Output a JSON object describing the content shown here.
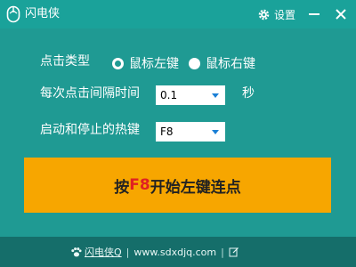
{
  "window": {
    "title": "闪电侠",
    "settings_label": "设置"
  },
  "form": {
    "click_type_label": "点击类型",
    "click_type_options": [
      "鼠标左键",
      "鼠标右键"
    ],
    "click_type_selected": "鼠标左键",
    "interval_label": "每次点击间隔时间",
    "interval_value": "0.1",
    "interval_unit": "秒",
    "hotkey_label": "启动和停止的热键",
    "hotkey_value": "F8"
  },
  "start_button": {
    "prefix": "按",
    "key": "F8",
    "suffix": "开始左键连点"
  },
  "footer": {
    "brand": "闪电侠Q",
    "site": "www.sdxdjq.com"
  },
  "colors": {
    "background": "#1f9a93",
    "button": "#f7a600",
    "hotkey_highlight": "#e02222"
  }
}
